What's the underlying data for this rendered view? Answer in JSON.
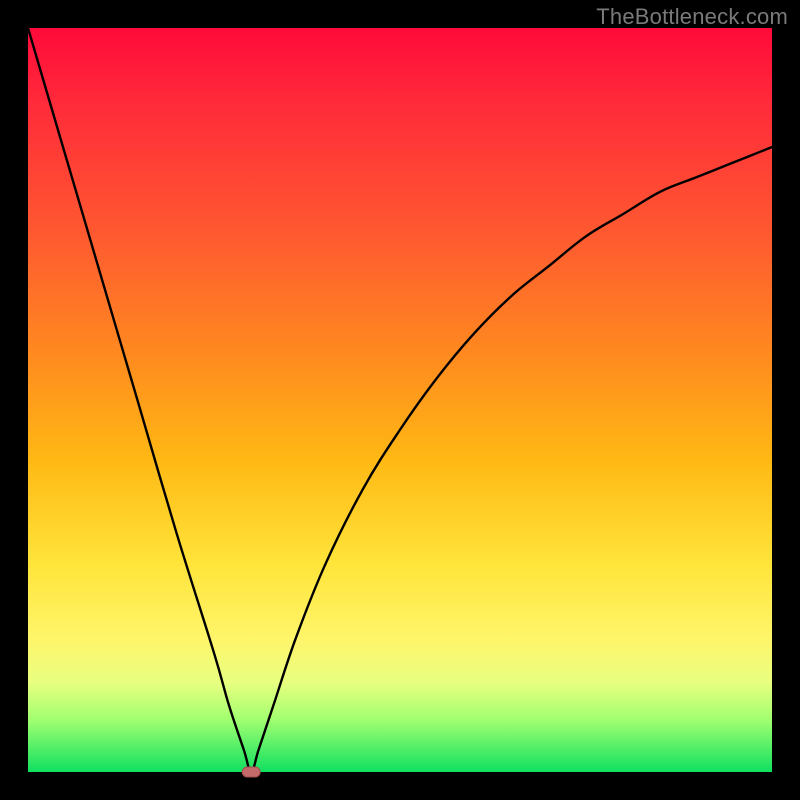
{
  "watermark": "TheBottleneck.com",
  "chart_data": {
    "type": "line",
    "title": "",
    "xlabel": "",
    "ylabel": "",
    "xlim": [
      0,
      100
    ],
    "ylim": [
      0,
      100
    ],
    "grid": false,
    "legend": false,
    "series": [
      {
        "name": "bottleneck-curve",
        "x": [
          0,
          5,
          10,
          15,
          20,
          25,
          27,
          29,
          30,
          31,
          33,
          36,
          40,
          45,
          50,
          55,
          60,
          65,
          70,
          75,
          80,
          85,
          90,
          95,
          100
        ],
        "values": [
          100,
          83,
          66,
          49,
          32,
          16,
          9,
          3,
          0,
          3,
          9,
          18,
          28,
          38,
          46,
          53,
          59,
          64,
          68,
          72,
          75,
          78,
          80,
          82,
          84
        ]
      }
    ],
    "annotations": [
      {
        "type": "marker",
        "shape": "rounded-rect",
        "x": 30,
        "y": 0,
        "label": "optimal-point",
        "color": "#c46a6a"
      }
    ],
    "background_gradient": {
      "direction": "vertical",
      "stops": [
        {
          "pos": 0.0,
          "color": "#ff0a3a"
        },
        {
          "pos": 0.45,
          "color": "#ff8a1f"
        },
        {
          "pos": 0.75,
          "color": "#ffe43a"
        },
        {
          "pos": 1.0,
          "color": "#10e060"
        }
      ]
    }
  }
}
